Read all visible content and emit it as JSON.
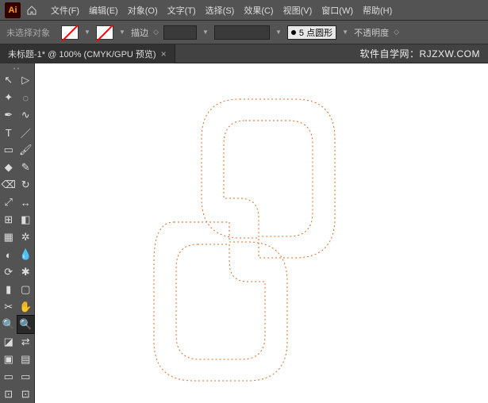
{
  "menu": {
    "items": [
      "文件(F)",
      "编辑(E)",
      "对象(O)",
      "文字(T)",
      "选择(S)",
      "效果(C)",
      "视图(V)",
      "窗口(W)",
      "帮助(H)"
    ]
  },
  "control": {
    "no_selection": "未选择对象",
    "stroke_label": "描边",
    "stroke_value": "",
    "brush_label": "5 点圆形",
    "opacity_label": "不透明度"
  },
  "tab": {
    "title": "未标题-1* @ 100% (CMYK/GPU 预览)"
  },
  "watermark": "软件自学网：RJZXW.COM",
  "tools": {
    "rows": [
      [
        "selection",
        "direct-selection"
      ],
      [
        "magic-wand",
        "lasso"
      ],
      [
        "pen",
        "curvature"
      ],
      [
        "type",
        "line"
      ],
      [
        "rectangle",
        "brush"
      ],
      [
        "shaper",
        "pencil"
      ],
      [
        "eraser",
        "rotate"
      ],
      [
        "scale",
        "width"
      ],
      [
        "free-transform",
        "shape-builder"
      ],
      [
        "perspective",
        "mesh"
      ],
      [
        "gradient",
        "eyedropper"
      ],
      [
        "blend",
        "symbol-sprayer"
      ],
      [
        "column-graph",
        "artboard"
      ],
      [
        "slice",
        "hand"
      ],
      [
        "zoom",
        "zoom2"
      ],
      [
        "fill-stroke",
        "swap"
      ],
      [
        "color",
        "gradient2"
      ],
      [
        "screen",
        "screen2"
      ],
      [
        "edit",
        "edit2"
      ]
    ]
  }
}
